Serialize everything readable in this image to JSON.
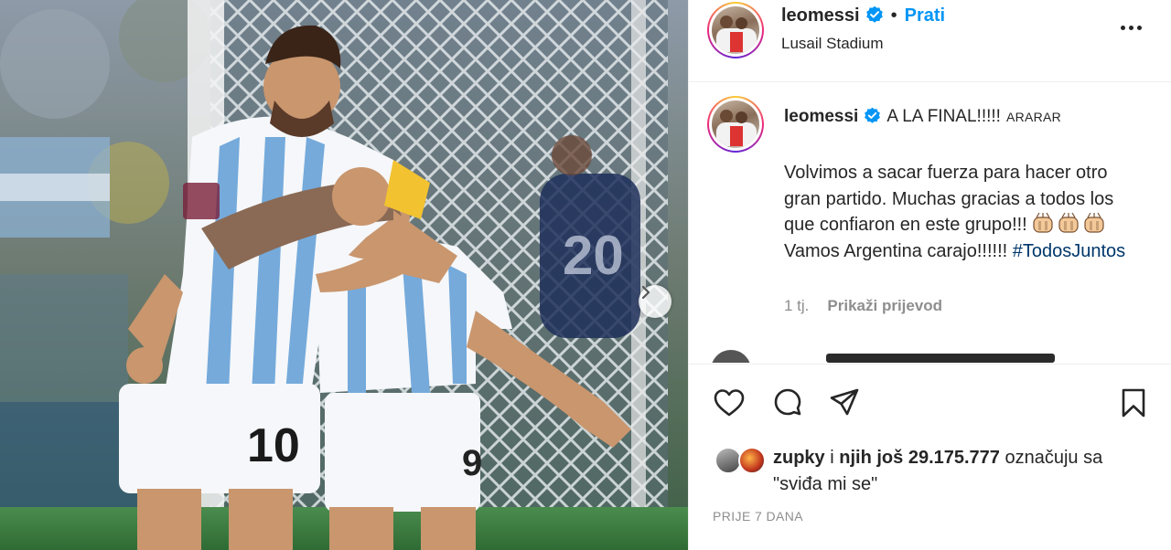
{
  "post": {
    "username": "leomessi",
    "follow_label": "Prati",
    "separator": "•",
    "location": "Lusail Stadium"
  },
  "caption": {
    "username": "leomessi",
    "first_line": "A LA FINAL!!!!!",
    "translated_tag": "ARARAR",
    "body_part1": "Volvimos a sacar fuerza para hacer otro gran partido. Muchas gracias a todos los que confiaron en este grupo!!!",
    "body_part2": "Vamos Argentina carajo!!!!!!",
    "hashtag": "#TodosJuntos",
    "age": "1 tj.",
    "see_translation": "Prikaži prijevod"
  },
  "likes": {
    "first_liker": "zupky",
    "connector": "i",
    "others": "njih još 29.175.777",
    "suffix": "označuju sa \"sviđa mi se\""
  },
  "timestamp": "PRIJE 7 DANA",
  "icons": {
    "like": "heart-icon",
    "comment": "comment-icon",
    "share": "share-icon",
    "save": "bookmark-icon",
    "more": "more-options-icon",
    "next": "chevron-right-icon",
    "verified": "verified-badge-icon"
  },
  "colors": {
    "link_blue": "#0095f6",
    "hashtag": "#00376b",
    "secondary_text": "#8e8e8e",
    "verified": "#0095f6"
  }
}
